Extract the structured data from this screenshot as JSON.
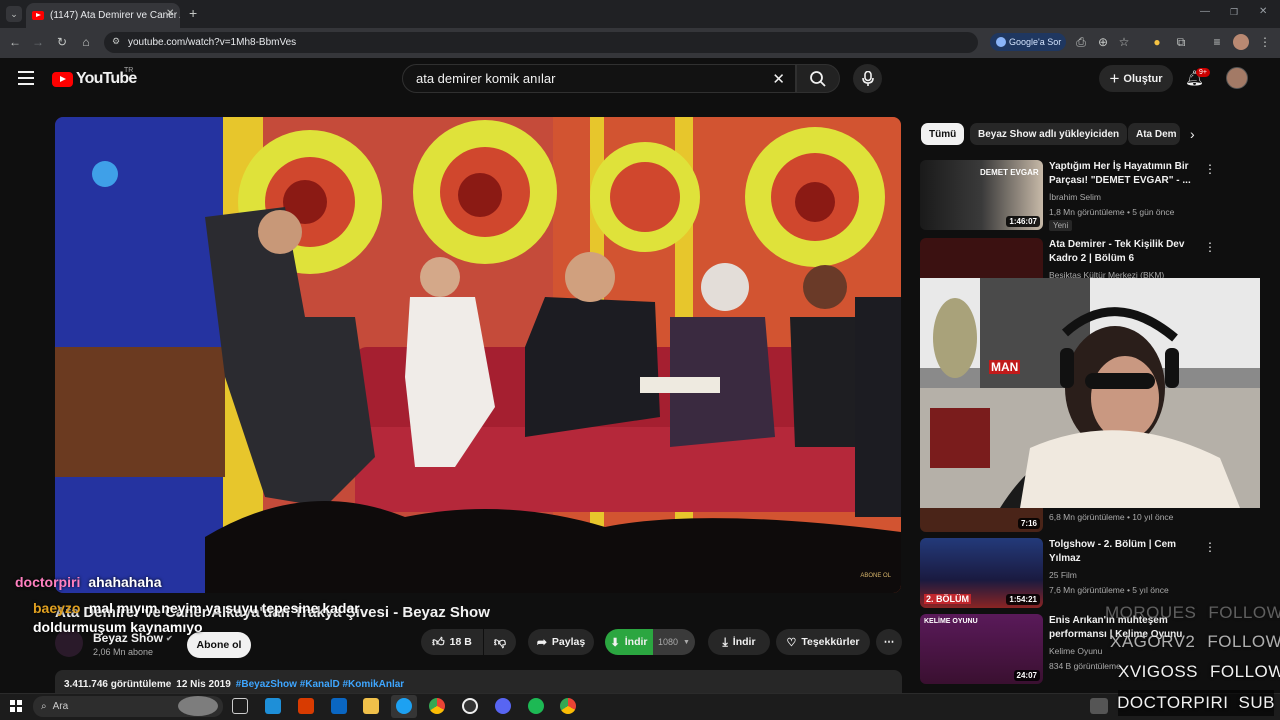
{
  "browser": {
    "tab_title": "(1147) Ata Demirer ve Caner Alk",
    "url": "youtube.com/watch?v=1Mh8-BbmVes",
    "google_sor": "Google'a Sor"
  },
  "youtube": {
    "logo": "YouTube",
    "region": "TR",
    "search_value": "ata demirer komik anılar",
    "create_label": "Oluştur",
    "notif_count": "9+"
  },
  "video": {
    "title": "Ata Demirer ve Caner Alkaya'dan Trakya Şivesi - Beyaz Show",
    "channel": "Beyaz Show",
    "subscribers": "2,06 Mn abone",
    "subscribe_label": "Abone ol",
    "likes": "18 B",
    "share_label": "Paylaş",
    "download_ext_label": "İndir",
    "quality": "1080",
    "download_label": "İndir",
    "thanks_label": "Teşekkürler",
    "views": "3.411.746 görüntüleme",
    "date": "12 Nis 2019",
    "hashtags": "#BeyazShow #KanalD #KomikAnlar",
    "watermark": "ABONE OL"
  },
  "chips": [
    "Tümü",
    "Beyaz Show adlı yükleyiciden",
    "Ata Dem"
  ],
  "recommendations": [
    {
      "title": "Yaptığım Her İş Hayatımın Bir Parçası! \"DEMET EVGAR\" - ...",
      "channel": "İbrahim Selim",
      "meta": "1,8 Mn görüntüleme • 5 gün önce",
      "duration": "1:46:07",
      "badge": "Yeni",
      "thumb_text": "DEMET EVGAR"
    },
    {
      "title": "Ata Demirer - Tek Kişilik Dev Kadro 2 | Bölüm 6",
      "channel": "Beşiktaş Kültür Merkezi (BKM)",
      "meta": "",
      "duration": ""
    },
    {
      "title": "",
      "channel": "",
      "meta": "6,8 Mn görüntüleme • 10 yıl önce",
      "duration": "7:16"
    },
    {
      "title": "Tolgshow - 2. Bölüm | Cem Yılmaz",
      "channel": "25 Film",
      "meta": "7,6 Mn görüntüleme • 5 yıl önce",
      "duration": "1:54:21",
      "thumb_text": "2. BÖLÜM"
    },
    {
      "title": "Enis Arıkan'ın muhteşem performansı | Kelime Oyunu",
      "channel": "Kelime Oyunu",
      "meta": "834 B görüntüleme",
      "duration": "24:07",
      "thumb_text": "KELİME OYUNU"
    }
  ],
  "stream_overlay": {
    "chat": [
      {
        "user": "doctorpiri",
        "message": "ahahahaha"
      },
      {
        "user": "baeyzo",
        "message": "mal mıyım neyim ya suyu tepesine kadar doldurmuşum kaynamıyo"
      }
    ],
    "alerts": [
      {
        "name": "MOROUES",
        "action": "FOLLOW"
      },
      {
        "name": "XAGORV2",
        "action": "FOLLOW"
      },
      {
        "name": "XVIGOSS",
        "action": "FOLLOW"
      },
      {
        "name": "DOCTORPIRI",
        "action": "SUB"
      }
    ],
    "cam_text": "MAN"
  },
  "taskbar": {
    "search_placeholder": "Ara"
  },
  "colors": {
    "youtube_red": "#ff0000",
    "download_green": "#2ba640",
    "background": "#0f0f0f"
  }
}
